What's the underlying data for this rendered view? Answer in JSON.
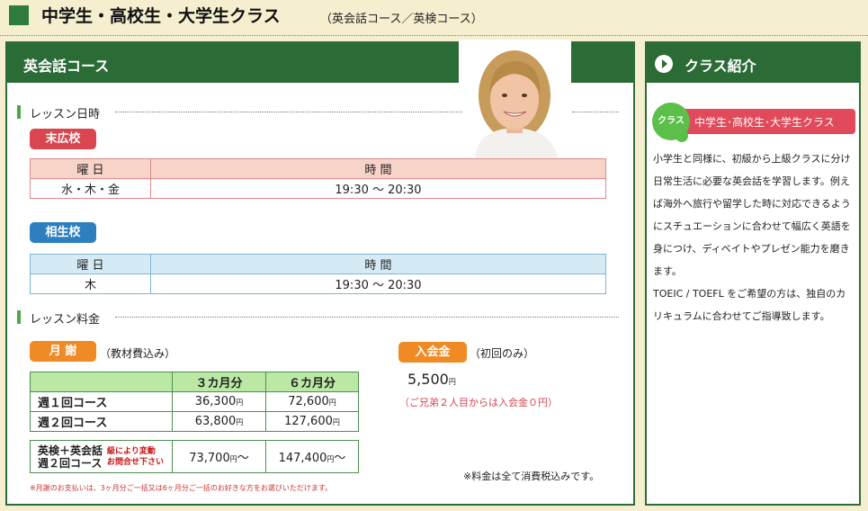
{
  "header": {
    "title": "中学生・高校生・大学生クラス",
    "subtitle": "（英会話コース／英検コース）"
  },
  "main": {
    "panel_title": "英会話コース",
    "lesson_schedule": {
      "label": "レッスン日時",
      "school1": {
        "name": "末広校",
        "col_day": "曜 日",
        "col_time": "時 間",
        "day": "水・木・金",
        "time": "19:30 〜 20:30"
      },
      "school2": {
        "name": "相生校",
        "col_day": "曜 日",
        "col_time": "時 間",
        "day": "木",
        "time": "19:30 〜 20:30"
      }
    },
    "lesson_fee": {
      "label": "レッスン料金",
      "monthly_badge": "月 謝",
      "monthly_note": "（教材費込み）",
      "col_3m": "３カ月分",
      "col_6m": "６カ月分",
      "rows": [
        {
          "course": "週１回コース",
          "v3": "36,300",
          "v6": "72,600"
        },
        {
          "course": "週２回コース",
          "v3": "63,800",
          "v6": "127,600"
        }
      ],
      "eiken": {
        "line1": "英検＋英会話",
        "line2": "週２回コース",
        "note1": "級により変動",
        "note2": "お問合せ下さい",
        "v3": "73,700",
        "v6": "147,400",
        "suffix": "〜"
      },
      "yen": "円",
      "payment_note": "※月謝のお支払いは、3ヶ月分ご一括又は6ヶ月分ご一括のお好きな方をお選びいただけます。",
      "entry_badge": "入会金",
      "entry_note": "（初回のみ）",
      "entry_amount": "5,500",
      "sibling_note": "（ご兄弟２人目からは入会金０円）",
      "tax_note": "※料金は全て消費税込みです。"
    }
  },
  "side": {
    "title": "クラス紹介",
    "badge": "クラス",
    "class_name": "中学生･高校生･大学生クラス",
    "description1": "小学生と同様に、初級から上級クラスに分け日常生活に必要な英会話を学習します。例えば海外へ旅行や留学した時に対応できるようにスチュエーションに合わせて幅広く英語を身につけ、ディベイトやプレゼン能力を磨きます。",
    "description2": "TOEIC / TOEFL をご希望の方は、独自のカリキュラムに合わせてご指導致します。"
  },
  "colors": {
    "green_dark": "#2a6b36",
    "red_badge": "#d9464f",
    "blue_badge": "#2e7fbf",
    "orange_badge": "#f08a24",
    "green_light": "#bce8a6"
  },
  "icons": {
    "side_title": "play-circle-icon",
    "photo": "student-photo"
  }
}
